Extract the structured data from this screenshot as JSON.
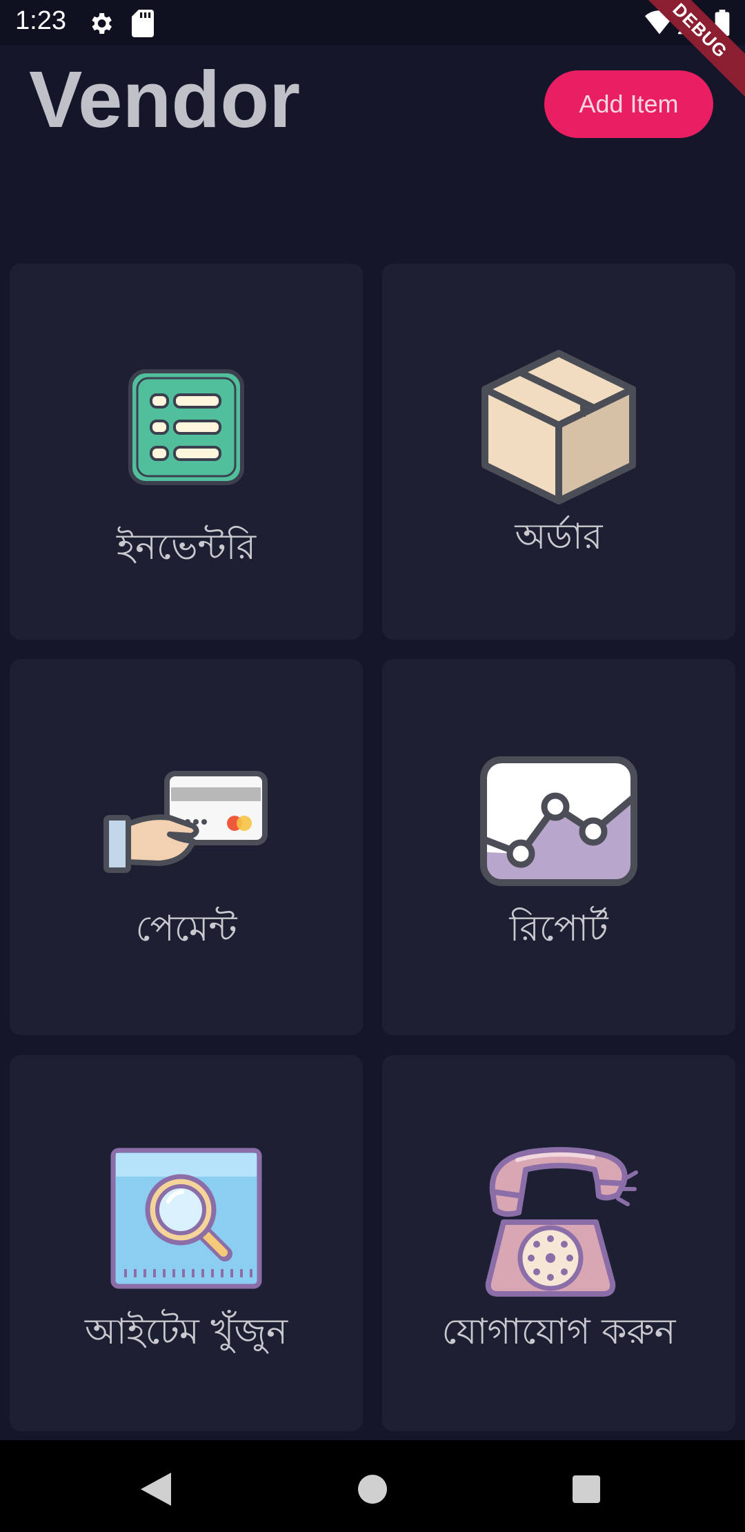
{
  "status_bar": {
    "time": "1:23",
    "icons": [
      "gear-icon",
      "sd-card-icon",
      "wifi-icon",
      "signal-icon",
      "battery-icon"
    ]
  },
  "debug_banner": "DEBUG",
  "header": {
    "title": "Vendor",
    "add_button_label": "Add Item"
  },
  "cards": [
    {
      "label": "ইনভেন্টরি",
      "icon": "inventory-list-icon"
    },
    {
      "label": "অর্ডার",
      "icon": "package-box-icon"
    },
    {
      "label": "পেমেন্ট",
      "icon": "card-payment-icon"
    },
    {
      "label": "রিপোর্ট",
      "icon": "report-chart-icon"
    },
    {
      "label": "আইটেম খুঁজুন",
      "icon": "search-item-icon"
    },
    {
      "label": "যোগাযোগ করুন",
      "icon": "telephone-icon"
    }
  ],
  "nav_bar": {
    "icons": [
      "back-icon",
      "home-icon",
      "recents-icon"
    ]
  },
  "colors": {
    "background": "#141629",
    "card": "#1d1f33",
    "accent": "#e91e63",
    "title": "#bfc0c8",
    "label": "#c9c9cf"
  }
}
